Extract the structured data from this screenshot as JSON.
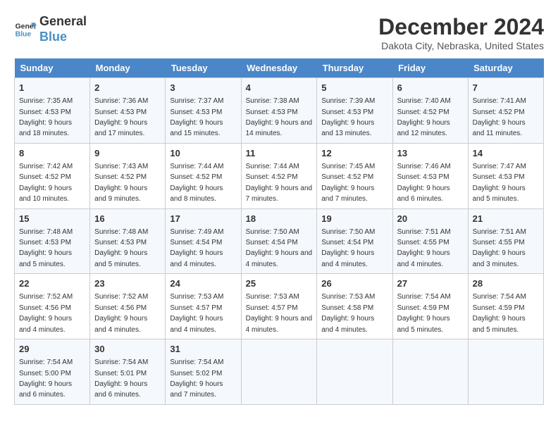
{
  "header": {
    "logo_line1": "General",
    "logo_line2": "Blue",
    "month_title": "December 2024",
    "location": "Dakota City, Nebraska, United States"
  },
  "days_of_week": [
    "Sunday",
    "Monday",
    "Tuesday",
    "Wednesday",
    "Thursday",
    "Friday",
    "Saturday"
  ],
  "weeks": [
    [
      {
        "day": 1,
        "rise": "7:35 AM",
        "set": "4:53 PM",
        "daylight": "9 hours and 18 minutes."
      },
      {
        "day": 2,
        "rise": "7:36 AM",
        "set": "4:53 PM",
        "daylight": "9 hours and 17 minutes."
      },
      {
        "day": 3,
        "rise": "7:37 AM",
        "set": "4:53 PM",
        "daylight": "9 hours and 15 minutes."
      },
      {
        "day": 4,
        "rise": "7:38 AM",
        "set": "4:53 PM",
        "daylight": "9 hours and 14 minutes."
      },
      {
        "day": 5,
        "rise": "7:39 AM",
        "set": "4:53 PM",
        "daylight": "9 hours and 13 minutes."
      },
      {
        "day": 6,
        "rise": "7:40 AM",
        "set": "4:52 PM",
        "daylight": "9 hours and 12 minutes."
      },
      {
        "day": 7,
        "rise": "7:41 AM",
        "set": "4:52 PM",
        "daylight": "9 hours and 11 minutes."
      }
    ],
    [
      {
        "day": 8,
        "rise": "7:42 AM",
        "set": "4:52 PM",
        "daylight": "9 hours and 10 minutes."
      },
      {
        "day": 9,
        "rise": "7:43 AM",
        "set": "4:52 PM",
        "daylight": "9 hours and 9 minutes."
      },
      {
        "day": 10,
        "rise": "7:44 AM",
        "set": "4:52 PM",
        "daylight": "9 hours and 8 minutes."
      },
      {
        "day": 11,
        "rise": "7:44 AM",
        "set": "4:52 PM",
        "daylight": "9 hours and 7 minutes."
      },
      {
        "day": 12,
        "rise": "7:45 AM",
        "set": "4:52 PM",
        "daylight": "9 hours and 7 minutes."
      },
      {
        "day": 13,
        "rise": "7:46 AM",
        "set": "4:53 PM",
        "daylight": "9 hours and 6 minutes."
      },
      {
        "day": 14,
        "rise": "7:47 AM",
        "set": "4:53 PM",
        "daylight": "9 hours and 5 minutes."
      }
    ],
    [
      {
        "day": 15,
        "rise": "7:48 AM",
        "set": "4:53 PM",
        "daylight": "9 hours and 5 minutes."
      },
      {
        "day": 16,
        "rise": "7:48 AM",
        "set": "4:53 PM",
        "daylight": "9 hours and 5 minutes."
      },
      {
        "day": 17,
        "rise": "7:49 AM",
        "set": "4:54 PM",
        "daylight": "9 hours and 4 minutes."
      },
      {
        "day": 18,
        "rise": "7:50 AM",
        "set": "4:54 PM",
        "daylight": "9 hours and 4 minutes."
      },
      {
        "day": 19,
        "rise": "7:50 AM",
        "set": "4:54 PM",
        "daylight": "9 hours and 4 minutes."
      },
      {
        "day": 20,
        "rise": "7:51 AM",
        "set": "4:55 PM",
        "daylight": "9 hours and 4 minutes."
      },
      {
        "day": 21,
        "rise": "7:51 AM",
        "set": "4:55 PM",
        "daylight": "9 hours and 3 minutes."
      }
    ],
    [
      {
        "day": 22,
        "rise": "7:52 AM",
        "set": "4:56 PM",
        "daylight": "9 hours and 4 minutes."
      },
      {
        "day": 23,
        "rise": "7:52 AM",
        "set": "4:56 PM",
        "daylight": "9 hours and 4 minutes."
      },
      {
        "day": 24,
        "rise": "7:53 AM",
        "set": "4:57 PM",
        "daylight": "9 hours and 4 minutes."
      },
      {
        "day": 25,
        "rise": "7:53 AM",
        "set": "4:57 PM",
        "daylight": "9 hours and 4 minutes."
      },
      {
        "day": 26,
        "rise": "7:53 AM",
        "set": "4:58 PM",
        "daylight": "9 hours and 4 minutes."
      },
      {
        "day": 27,
        "rise": "7:54 AM",
        "set": "4:59 PM",
        "daylight": "9 hours and 5 minutes."
      },
      {
        "day": 28,
        "rise": "7:54 AM",
        "set": "4:59 PM",
        "daylight": "9 hours and 5 minutes."
      }
    ],
    [
      {
        "day": 29,
        "rise": "7:54 AM",
        "set": "5:00 PM",
        "daylight": "9 hours and 6 minutes."
      },
      {
        "day": 30,
        "rise": "7:54 AM",
        "set": "5:01 PM",
        "daylight": "9 hours and 6 minutes."
      },
      {
        "day": 31,
        "rise": "7:54 AM",
        "set": "5:02 PM",
        "daylight": "9 hours and 7 minutes."
      },
      null,
      null,
      null,
      null
    ]
  ]
}
